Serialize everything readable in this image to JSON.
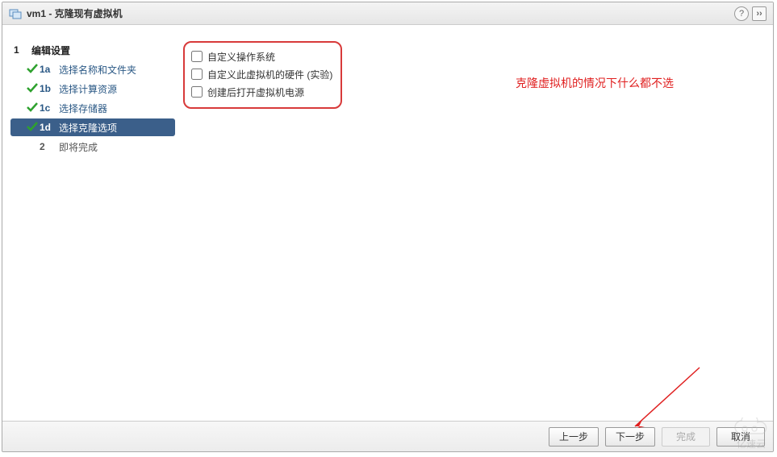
{
  "titlebar": {
    "title": "vm1 - 克隆现有虚拟机",
    "help": "?",
    "adv": "››"
  },
  "sidebar": {
    "step1": {
      "num": "1",
      "label": "编辑设置"
    },
    "step1a": {
      "num": "1a",
      "label": "选择名称和文件夹"
    },
    "step1b": {
      "num": "1b",
      "label": "选择计算资源"
    },
    "step1c": {
      "num": "1c",
      "label": "选择存储器"
    },
    "step1d": {
      "num": "1d",
      "label": "选择克隆选项"
    },
    "step2": {
      "num": "2",
      "label": "即将完成"
    }
  },
  "options": {
    "o1": "自定义操作系统",
    "o2": "自定义此虚拟机的硬件 (实验)",
    "o3": "创建后打开虚拟机电源"
  },
  "annotation": "克隆虚拟机的情况下什么都不选",
  "footer": {
    "back": "上一步",
    "next": "下一步",
    "finish": "完成",
    "cancel": "取消"
  },
  "watermark": "亿速云"
}
